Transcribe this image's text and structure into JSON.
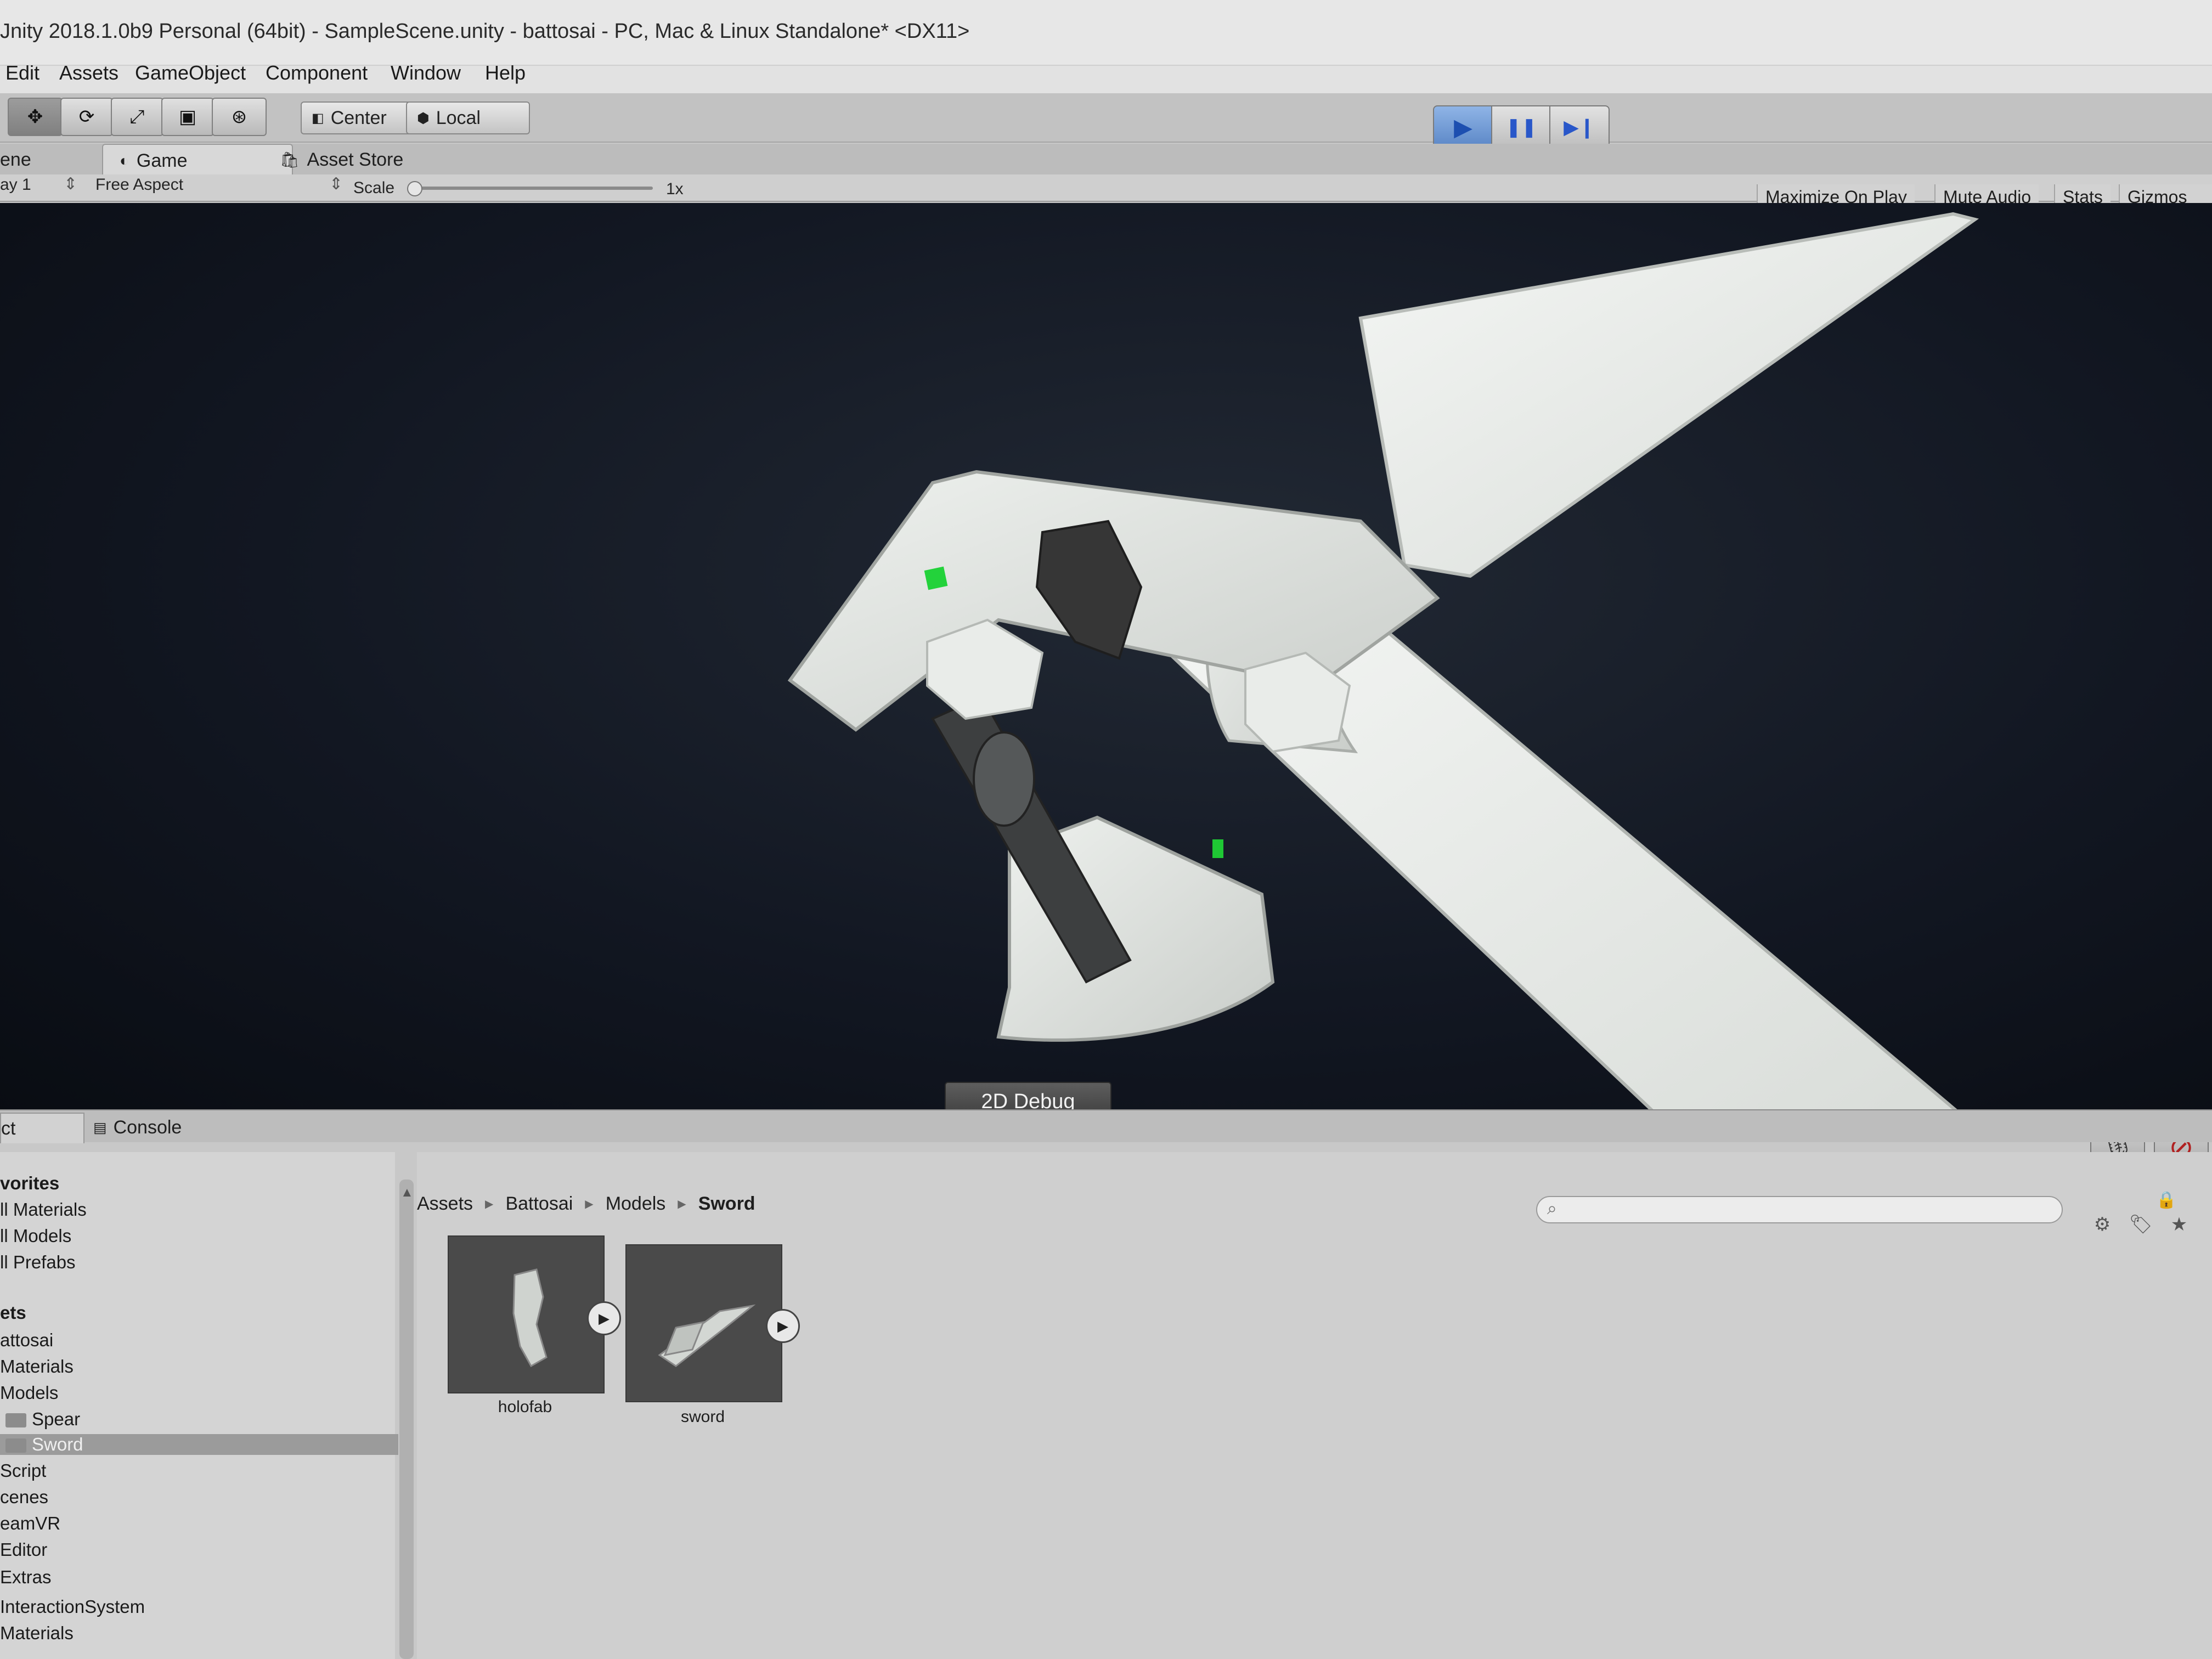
{
  "window": {
    "title": "Jnity 2018.1.0b9 Personal (64bit) - SampleScene.unity - battosai - PC, Mac & Linux Standalone* <DX11>"
  },
  "menu": {
    "items": [
      "Edit",
      "Assets",
      "GameObject",
      "Component",
      "Window",
      "Help"
    ]
  },
  "toolbar": {
    "tools": [
      {
        "name": "move-tool",
        "glyph": "✥"
      },
      {
        "name": "rotate-tool",
        "glyph": "⟳"
      },
      {
        "name": "scale-tool",
        "glyph": "⤢"
      },
      {
        "name": "rect-tool",
        "glyph": "▣"
      },
      {
        "name": "transform-tool",
        "glyph": "⊛"
      }
    ],
    "pivot_label": "Center",
    "space_label": "Local",
    "play_glyph": "▶",
    "pause_glyph": "❚❚",
    "step_glyph": "▶❙"
  },
  "tabs": {
    "scene": "ene",
    "game": "Game",
    "asset_store": "Asset Store"
  },
  "game_toolbar": {
    "display": "ay 1",
    "aspect": "Free Aspect",
    "scale_label": "Scale",
    "scale_value": "1x",
    "scale_level": 0.0,
    "maximize": "Maximize On Play",
    "mute": "Mute Audio",
    "stats": "Stats",
    "gizmos": "Gizmos"
  },
  "viewport": {
    "debug_button": "2D Debug",
    "mic_icon": "microphone-icon",
    "block_icon": "no-entry-icon"
  },
  "bottom_tabs": {
    "project": "ct",
    "console": "Console"
  },
  "tree": {
    "favorites_header": "vorites",
    "favorites": [
      "ll Materials",
      "ll Models",
      "ll Prefabs"
    ],
    "assets_header": "ets",
    "assets": [
      {
        "label": "attosai",
        "indent": 0,
        "folder": false,
        "selected": false
      },
      {
        "label": "Materials",
        "indent": 0,
        "folder": false,
        "selected": false
      },
      {
        "label": "Models",
        "indent": 0,
        "folder": false,
        "selected": false
      },
      {
        "label": "Spear",
        "indent": 1,
        "folder": true,
        "selected": false
      },
      {
        "label": "Sword",
        "indent": 1,
        "folder": true,
        "selected": true
      },
      {
        "label": "Script",
        "indent": 0,
        "folder": false,
        "selected": false
      },
      {
        "label": "cenes",
        "indent": 0,
        "folder": false,
        "selected": false
      },
      {
        "label": "eamVR",
        "indent": 0,
        "folder": false,
        "selected": false
      },
      {
        "label": "Editor",
        "indent": 0,
        "folder": false,
        "selected": false
      },
      {
        "label": "Extras",
        "indent": 0,
        "folder": false,
        "selected": false
      },
      {
        "label": "InteractionSystem",
        "indent": 0,
        "folder": false,
        "selected": false
      },
      {
        "label": "Materials",
        "indent": 0,
        "folder": false,
        "selected": false
      }
    ]
  },
  "breadcrumb": [
    "Assets",
    "Battosai",
    "Models",
    "Sword"
  ],
  "assets": [
    {
      "label": "holofab"
    },
    {
      "label": "sword"
    }
  ]
}
